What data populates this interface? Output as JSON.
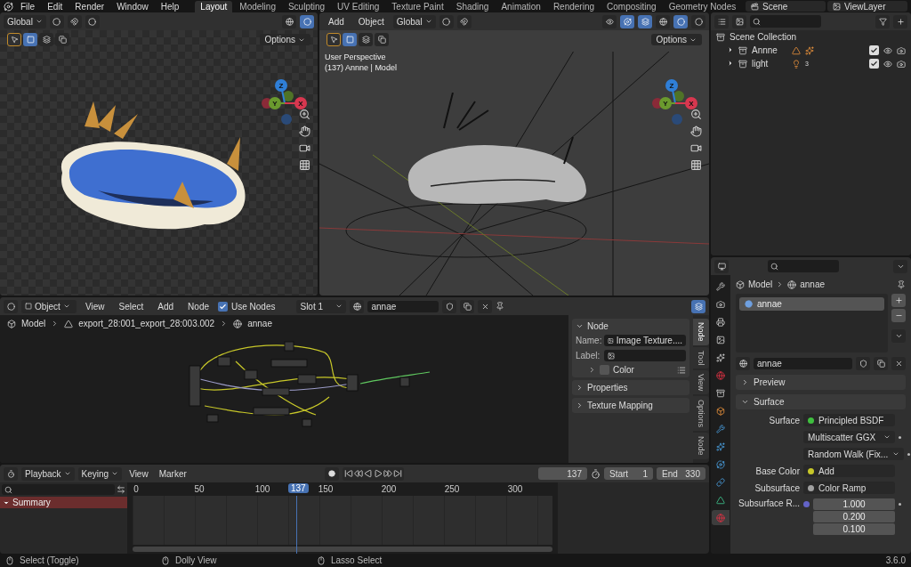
{
  "top_bar": {
    "menus": [
      "File",
      "Edit",
      "Render",
      "Window",
      "Help"
    ],
    "workspaces": [
      {
        "label": "Layout",
        "selected": true
      },
      {
        "label": "Modeling",
        "selected": false
      },
      {
        "label": "Sculpting",
        "selected": false
      },
      {
        "label": "UV Editing",
        "selected": false
      },
      {
        "label": "Texture Paint",
        "selected": false
      },
      {
        "label": "Shading",
        "selected": false
      },
      {
        "label": "Animation",
        "selected": false
      },
      {
        "label": "Rendering",
        "selected": false
      },
      {
        "label": "Compositing",
        "selected": false
      },
      {
        "label": "Geometry Nodes",
        "selected": false
      }
    ],
    "scene": "Scene",
    "view_layer": "ViewLayer"
  },
  "image_editor": {
    "orientation": "Global",
    "options": "Options",
    "gizmo": [
      {
        "label": "Z",
        "color": "#2f7fd8"
      },
      {
        "label": "Y",
        "color": "#6a9a2e"
      },
      {
        "label": "X",
        "color": "#d8374f"
      }
    ]
  },
  "viewport": {
    "menus": [
      "Add",
      "Object"
    ],
    "orientation": "Global",
    "options": "Options",
    "info": [
      "User Perspective",
      "(137) Annne | Model"
    ],
    "gizmo": [
      {
        "label": "Z",
        "color": "#2f7fd8"
      },
      {
        "label": "Y",
        "color": "#6a9a2e"
      },
      {
        "label": "X",
        "color": "#d8374f"
      }
    ]
  },
  "outliner": {
    "root": "Scene Collection",
    "items": [
      {
        "name": "Annne",
        "expanded": false,
        "enabled": true
      },
      {
        "name": "light",
        "badge": "3",
        "expanded": false,
        "enabled": true
      }
    ]
  },
  "node_editor": {
    "mode": "Object",
    "menus": [
      "View",
      "Select",
      "Add",
      "Node"
    ],
    "use_nodes": {
      "label": "Use Nodes",
      "checked": true
    },
    "slot": "Slot 1",
    "material": "annae",
    "breadcrumb": [
      "Model",
      "export_28:001_export_28:003.002",
      "annae"
    ],
    "panels": [
      {
        "label": "Node",
        "expanded": true
      },
      {
        "label": "Properties",
        "expanded": false
      },
      {
        "label": "Texture Mapping",
        "expanded": false
      }
    ],
    "name_label": "Name:",
    "name_value": "Image Texture....",
    "label_label": "Label:",
    "color": {
      "label": "Color",
      "checked": false
    },
    "tabs": [
      {
        "label": "Node",
        "selected": true
      },
      {
        "label": "Tool",
        "selected": false
      },
      {
        "label": "View",
        "selected": false
      },
      {
        "label": "Options",
        "selected": false
      },
      {
        "label": "Node",
        "selected": false
      }
    ]
  },
  "timeline": {
    "menus": [
      "Playback",
      "Keying",
      "View",
      "Marker"
    ],
    "current_frame": "137",
    "start_label": "Start",
    "start": "1",
    "end_label": "End",
    "end": "330",
    "ruler": [
      "0",
      "50",
      "100",
      "150",
      "200",
      "250",
      "300"
    ],
    "playhead": "137",
    "channels": [
      {
        "label": "Summary",
        "expanded": true
      }
    ]
  },
  "properties": {
    "tabs": [
      {
        "selected": false
      },
      {
        "selected": false
      },
      {
        "selected": false
      },
      {
        "selected": false
      },
      {
        "selected": false
      },
      {
        "selected": false
      },
      {
        "selected": false
      },
      {
        "selected": false
      },
      {
        "selected": false
      },
      {
        "selected": false
      },
      {
        "selected": false
      },
      {
        "selected": false
      },
      {
        "selected": false
      },
      {
        "selected": true
      }
    ],
    "breadcrumb": [
      "Model",
      "annae"
    ],
    "slots": [
      {
        "name": "annae",
        "selected": true
      }
    ],
    "material": "annae",
    "panels": [
      {
        "label": "Preview",
        "expanded": false
      },
      {
        "label": "Surface",
        "expanded": true
      }
    ],
    "rows": [
      {
        "kind": "link",
        "label": "Surface",
        "value": "Principled BSDF",
        "color": "#3fbf3f"
      },
      {
        "kind": "dropdown",
        "value": "Multiscatter GGX"
      },
      {
        "kind": "dropdown",
        "value": "Random Walk (Fix..."
      },
      {
        "kind": "link",
        "label": "Base Color",
        "value": "Add",
        "color": "#c7c729"
      },
      {
        "kind": "link",
        "label": "Subsurface",
        "value": "Color Ramp",
        "color": "#a1a1a1"
      },
      {
        "kind": "vector",
        "label": "Subsurface R...",
        "color": "#6363c7",
        "values": [
          "1.000",
          "0.200",
          "0.100"
        ]
      }
    ]
  },
  "status_bar": {
    "hints": [
      "Select (Toggle)",
      "Dolly View",
      "Lasso Select"
    ],
    "version": "3.6.0"
  }
}
